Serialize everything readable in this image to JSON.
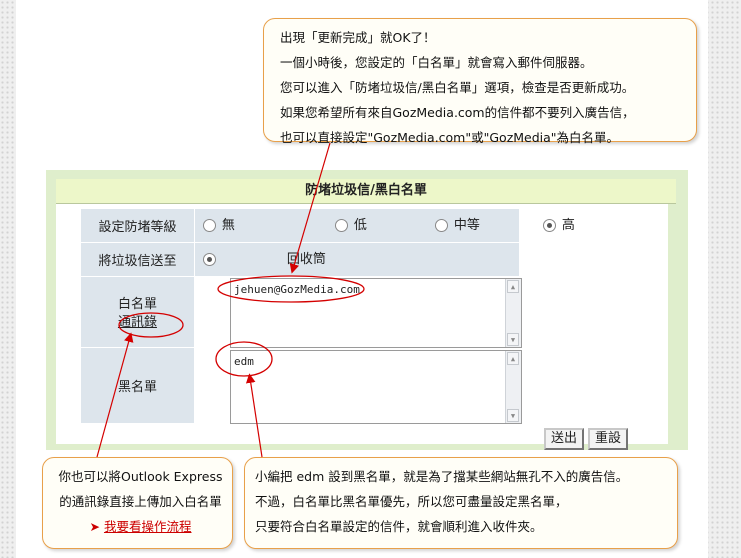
{
  "callout_top": {
    "lines": [
      "出現「更新完成」就OK了！",
      "一個小時後，您設定的「白名單」就會寫入郵件伺服器。",
      "您可以進入「防堵垃圾信/黑白名單」選項，檢查是否更新成功。",
      "如果您希望所有來自GozMedia.com的信件都不要列入廣告信，",
      "也可以直接設定\"GozMedia.com\"或\"GozMedia\"為白名單。"
    ]
  },
  "panel": {
    "title": "防堵垃圾信/黑白名單",
    "level_label": "設定防堵等級",
    "levels": [
      {
        "label": "無",
        "selected": false
      },
      {
        "label": "低",
        "selected": false
      },
      {
        "label": "中等",
        "selected": false
      },
      {
        "label": "高",
        "selected": true
      }
    ],
    "spam_label": "將垃圾信送至",
    "spam_option": "回收筒",
    "whitelist_label": "白名單",
    "contacts_link": "通訊錄",
    "whitelist_value": "jehuen@GozMedia.com",
    "blacklist_label": "黑名單",
    "blacklist_value": "edm",
    "submit_label": "送出",
    "reset_label": "重設"
  },
  "callout_left": {
    "line1": "你也可以將Outlook Express",
    "line2": "的通訊錄直接上傳加入白名單",
    "marker": "➤",
    "link": "我要看操作流程"
  },
  "callout_right": {
    "lines": [
      "小編把 edm 設到黑名單，就是為了擋某些網站無孔不入的廣告信。",
      "不過，白名單比黑名單優先，所以您可盡量設定黑名單，",
      "只要符合白名單設定的信件，就會順利進入收件夾。"
    ]
  },
  "colors": {
    "callout_border": "#e8a04a",
    "annotation_red": "#d40000",
    "panel_bg": "#dfeecc",
    "row_bg": "#dde5ec"
  }
}
